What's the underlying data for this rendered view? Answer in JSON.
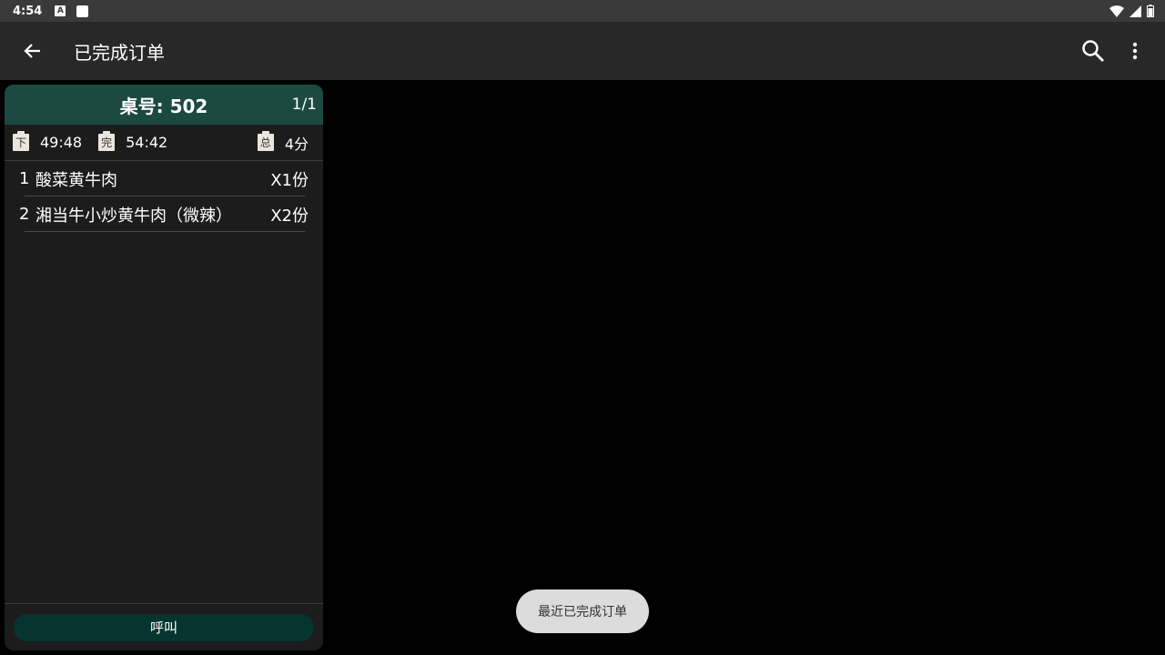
{
  "status_bar": {
    "time": "4:54",
    "icons": [
      "a-notification-icon",
      "square-notification-icon",
      "wifi-icon",
      "signal-icon",
      "battery-icon"
    ]
  },
  "toolbar": {
    "title": "已完成订单",
    "icons": [
      "back-arrow-icon",
      "search-icon",
      "more-vert-icon"
    ]
  },
  "order": {
    "table_label": "桌号: 502",
    "page": "1/1",
    "order_badge": "下",
    "order_time": "49:48",
    "done_badge": "完",
    "done_time": "54:42",
    "total_badge": "总",
    "total_time": "4分",
    "items": [
      {
        "index": "1",
        "name": "酸菜黄牛肉",
        "qty": "X1份"
      },
      {
        "index": "2",
        "name": "湘当牛小炒黄牛肉（微辣）",
        "qty": "X2份"
      }
    ],
    "call_label": "呼叫"
  },
  "toast": {
    "text": "最近已完成订单"
  },
  "colors": {
    "header_bg": "#1c4a43",
    "call_button_bg": "#063530",
    "card_bg": "#1c1c1c",
    "toolbar_bg": "#282828",
    "toast_bg": "#dcdcdc"
  }
}
